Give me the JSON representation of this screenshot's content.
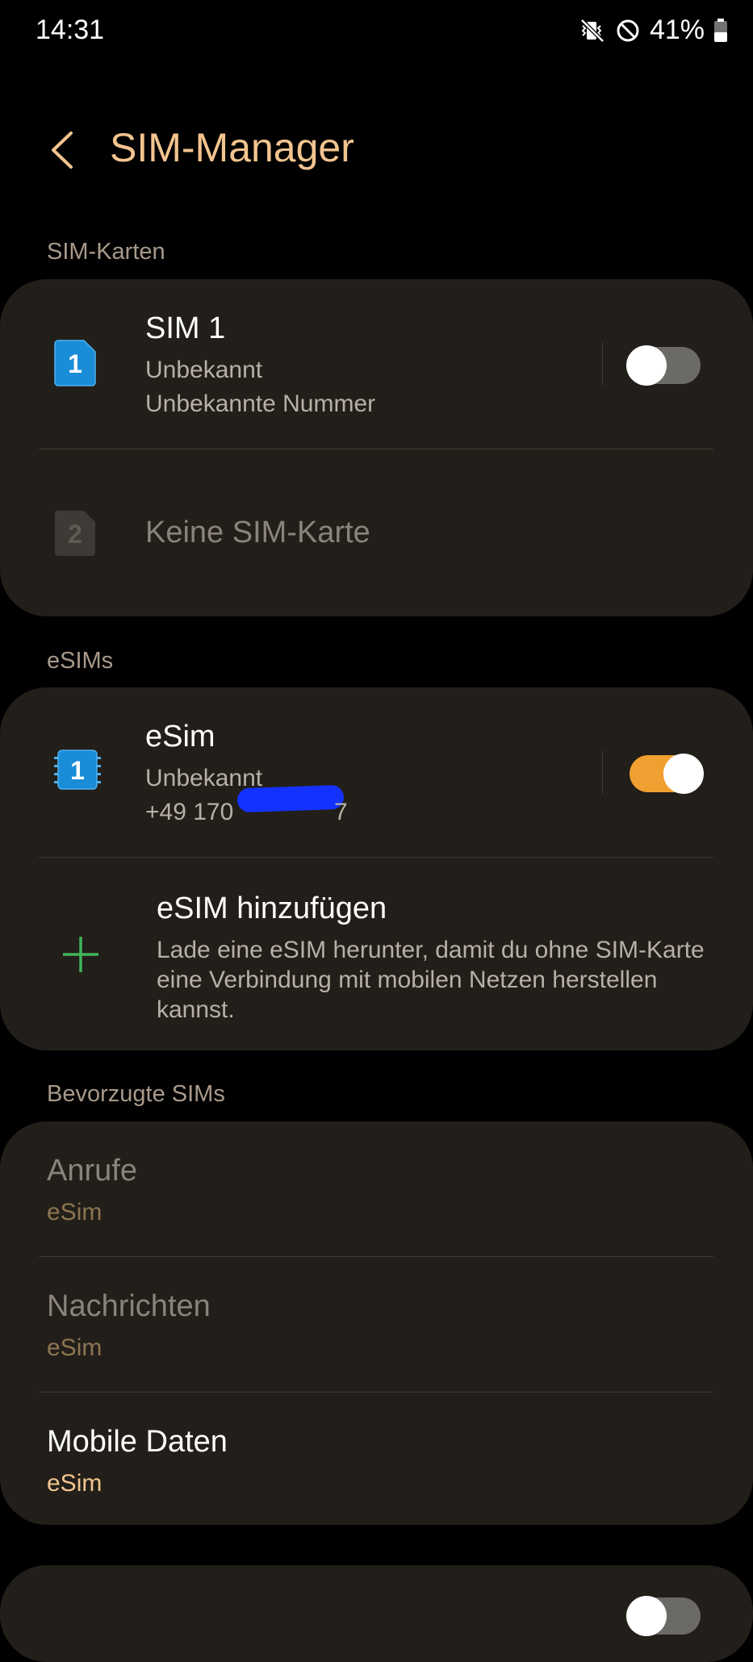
{
  "status": {
    "time": "14:31",
    "battery": "41%",
    "icons": [
      "vibrate-mute-icon",
      "do-not-disturb-icon",
      "battery-icon"
    ]
  },
  "header": {
    "title": "SIM-Manager",
    "back_icon": "back-arrow-icon"
  },
  "sim_cards": {
    "section_label": "SIM-Karten",
    "sim1": {
      "slot": "1",
      "title": "SIM 1",
      "status": "Unbekannt",
      "number": "Unbekannte Nummer",
      "enabled": false
    },
    "sim2": {
      "slot": "2",
      "title": "Keine SIM-Karte"
    }
  },
  "esims": {
    "section_label": "eSIMs",
    "esim1": {
      "slot": "1",
      "title": "eSim",
      "status": "Unbekannt",
      "number": "+49 170",
      "number_suffix": "7",
      "enabled": true
    },
    "add": {
      "title": "eSIM hinzufügen",
      "description": "Lade eine eSIM herunter, damit du ohne SIM-Karte eine Verbindung mit mobilen Netzen herstellen kannst.",
      "icon": "plus-icon"
    }
  },
  "preferred": {
    "section_label": "Bevorzugte SIMs",
    "calls": {
      "title": "Anrufe",
      "value": "eSim"
    },
    "messages": {
      "title": "Nachrichten",
      "value": "eSim"
    },
    "mobile_data": {
      "title": "Mobile Daten",
      "value": "eSim"
    }
  },
  "colors": {
    "accent": "#f2c48f",
    "toggle_on": "#f0a030",
    "card_bg": "#221e19",
    "sim_blue": "#1a8cd8",
    "plus_green": "#3fb55a"
  }
}
